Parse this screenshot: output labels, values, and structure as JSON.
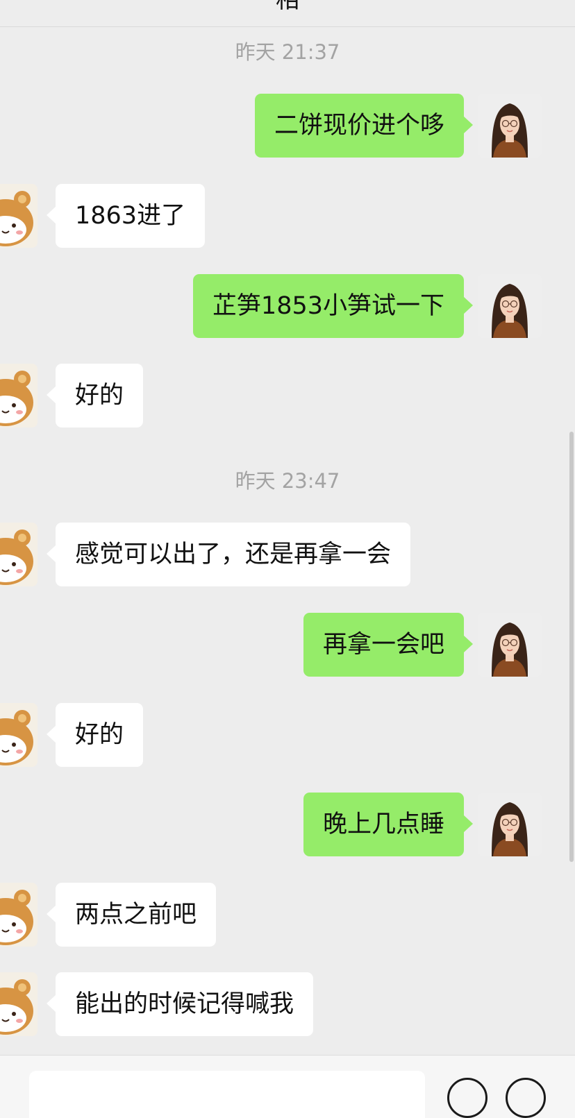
{
  "header": {
    "title": "相"
  },
  "messages": [
    {
      "type": "time",
      "text": "昨天 21:37"
    },
    {
      "type": "msg",
      "from": "me",
      "text": "二饼现价进个哆"
    },
    {
      "type": "msg",
      "from": "other",
      "text": "1863进了"
    },
    {
      "type": "msg",
      "from": "me",
      "text": "芷笋1853小笋试一下"
    },
    {
      "type": "msg",
      "from": "other",
      "text": "好的"
    },
    {
      "type": "time",
      "text": "昨天 23:47"
    },
    {
      "type": "msg",
      "from": "other",
      "text": "感觉可以出了，还是再拿一会"
    },
    {
      "type": "msg",
      "from": "me",
      "text": "再拿一会吧"
    },
    {
      "type": "msg",
      "from": "other",
      "text": "好的"
    },
    {
      "type": "msg",
      "from": "me",
      "text": "晚上几点睡"
    },
    {
      "type": "msg",
      "from": "other",
      "text": "两点之前吧"
    },
    {
      "type": "msg",
      "from": "other",
      "text": "能出的时候记得喊我"
    }
  ],
  "icons": {
    "me_avatar": "woman-with-glasses-avatar",
    "other_avatar": "bear-cartoon-avatar",
    "voice": "voice-icon",
    "emoji": "emoji-icon",
    "more": "plus-icon"
  },
  "colors": {
    "background": "#ededed",
    "my_bubble": "#95ec69",
    "other_bubble": "#ffffff",
    "timestamp": "#a3a3a3"
  }
}
